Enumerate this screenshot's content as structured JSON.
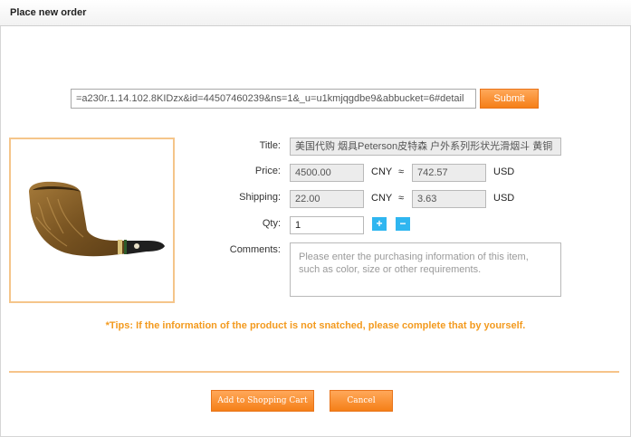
{
  "header": {
    "title": "Place new order"
  },
  "url_bar": {
    "value": "=a230r.1.14.102.8KIDzx&id=44507460239&ns=1&_u=u1kmjqgdbe9&abbucket=6#detail",
    "submit_label": "Submit"
  },
  "product": {
    "image_icon": "tobacco-pipe-image",
    "title_label": "Title:",
    "title_value": "美国代购 烟具Peterson皮特森 户外系列形状光滑烟斗 黄铜",
    "price_label": "Price:",
    "price_cny": "4500.00",
    "price_cny_unit": "CNY",
    "approx": "≈",
    "price_usd": "742.57",
    "price_usd_unit": "USD",
    "shipping_label": "Shipping:",
    "shipping_cny": "22.00",
    "shipping_cny_unit": "CNY",
    "shipping_usd": "3.63",
    "shipping_usd_unit": "USD",
    "qty_label": "Qty:",
    "qty_value": "1",
    "qty_plus": "+",
    "qty_minus": "−",
    "comments_label": "Comments:",
    "comments_placeholder": "Please enter the purchasing information of this item, such as color, size or other requirements."
  },
  "tips": "*Tips: If the information of the product is not snatched, please complete that by yourself.",
  "actions": {
    "add_to_cart_label": "Add to Shopping Cart",
    "cancel_label": "Cancel"
  },
  "colors": {
    "accent_orange": "#f57f17",
    "tip_orange": "#f39a1e",
    "qty_blue": "#2fb6f0",
    "border_orange": "#f5c58a"
  }
}
